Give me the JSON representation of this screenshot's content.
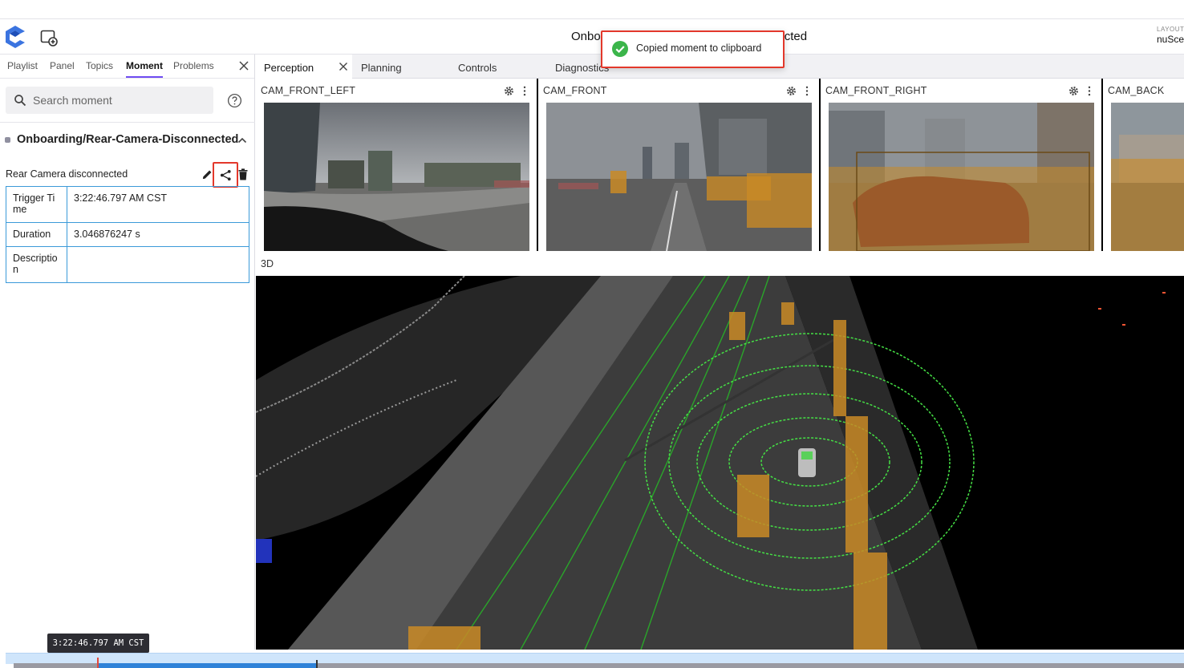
{
  "app": {
    "title_left": "Onbo",
    "title_right": "cted",
    "layout_label": "LAYOUT",
    "layout_value": "nuSce"
  },
  "icons": {
    "logo": "foxglove-logo-icon",
    "add_panel": "add-panel-icon",
    "close": "close-icon",
    "search": "search-icon",
    "help": "help-circle-icon",
    "chevron": "chevron-up-icon",
    "edit": "pencil-icon",
    "share": "share-icon",
    "delete": "trash-icon",
    "gear": "gear-icon",
    "more": "more-vertical-icon",
    "success": "check-circle-icon"
  },
  "colors": {
    "accent": "#6f4cf2",
    "highlight": "#e3382b",
    "table_border": "#3b9ad9",
    "success": "#3bb54a",
    "timeline_fill": "#2f82d8"
  },
  "sidebar": {
    "tabs": [
      {
        "label": "Playlist"
      },
      {
        "label": "Panel"
      },
      {
        "label": "Topics"
      },
      {
        "label": "Moment",
        "active": true
      },
      {
        "label": "Problems"
      }
    ],
    "search_placeholder": "Search moment",
    "group_title": "Onboarding/Rear-Camera-Disconnected",
    "moment": {
      "name": "Rear Camera disconnected",
      "fields": [
        {
          "key": "Trigger Ti\nme",
          "value": "3:22:46.797 AM CST"
        },
        {
          "key": "Duration",
          "value": "3.046876247 s"
        },
        {
          "key": "Descriptio\nn",
          "value": ""
        }
      ]
    }
  },
  "main": {
    "tabs": [
      {
        "label": "Perception",
        "active": true
      },
      {
        "label": "Planning"
      },
      {
        "label": "Controls"
      },
      {
        "label": "Diagnostics"
      }
    ],
    "cameras": [
      {
        "title": "CAM_FRONT_LEFT"
      },
      {
        "title": "CAM_FRONT"
      },
      {
        "title": "CAM_FRONT_RIGHT"
      },
      {
        "title": "CAM_BACK"
      }
    ],
    "threed_title": "3D"
  },
  "toast": {
    "message": "Copied moment to clipboard"
  },
  "timeline": {
    "current_time": "3:22:46.797 AM CST",
    "progress": 0.185
  }
}
